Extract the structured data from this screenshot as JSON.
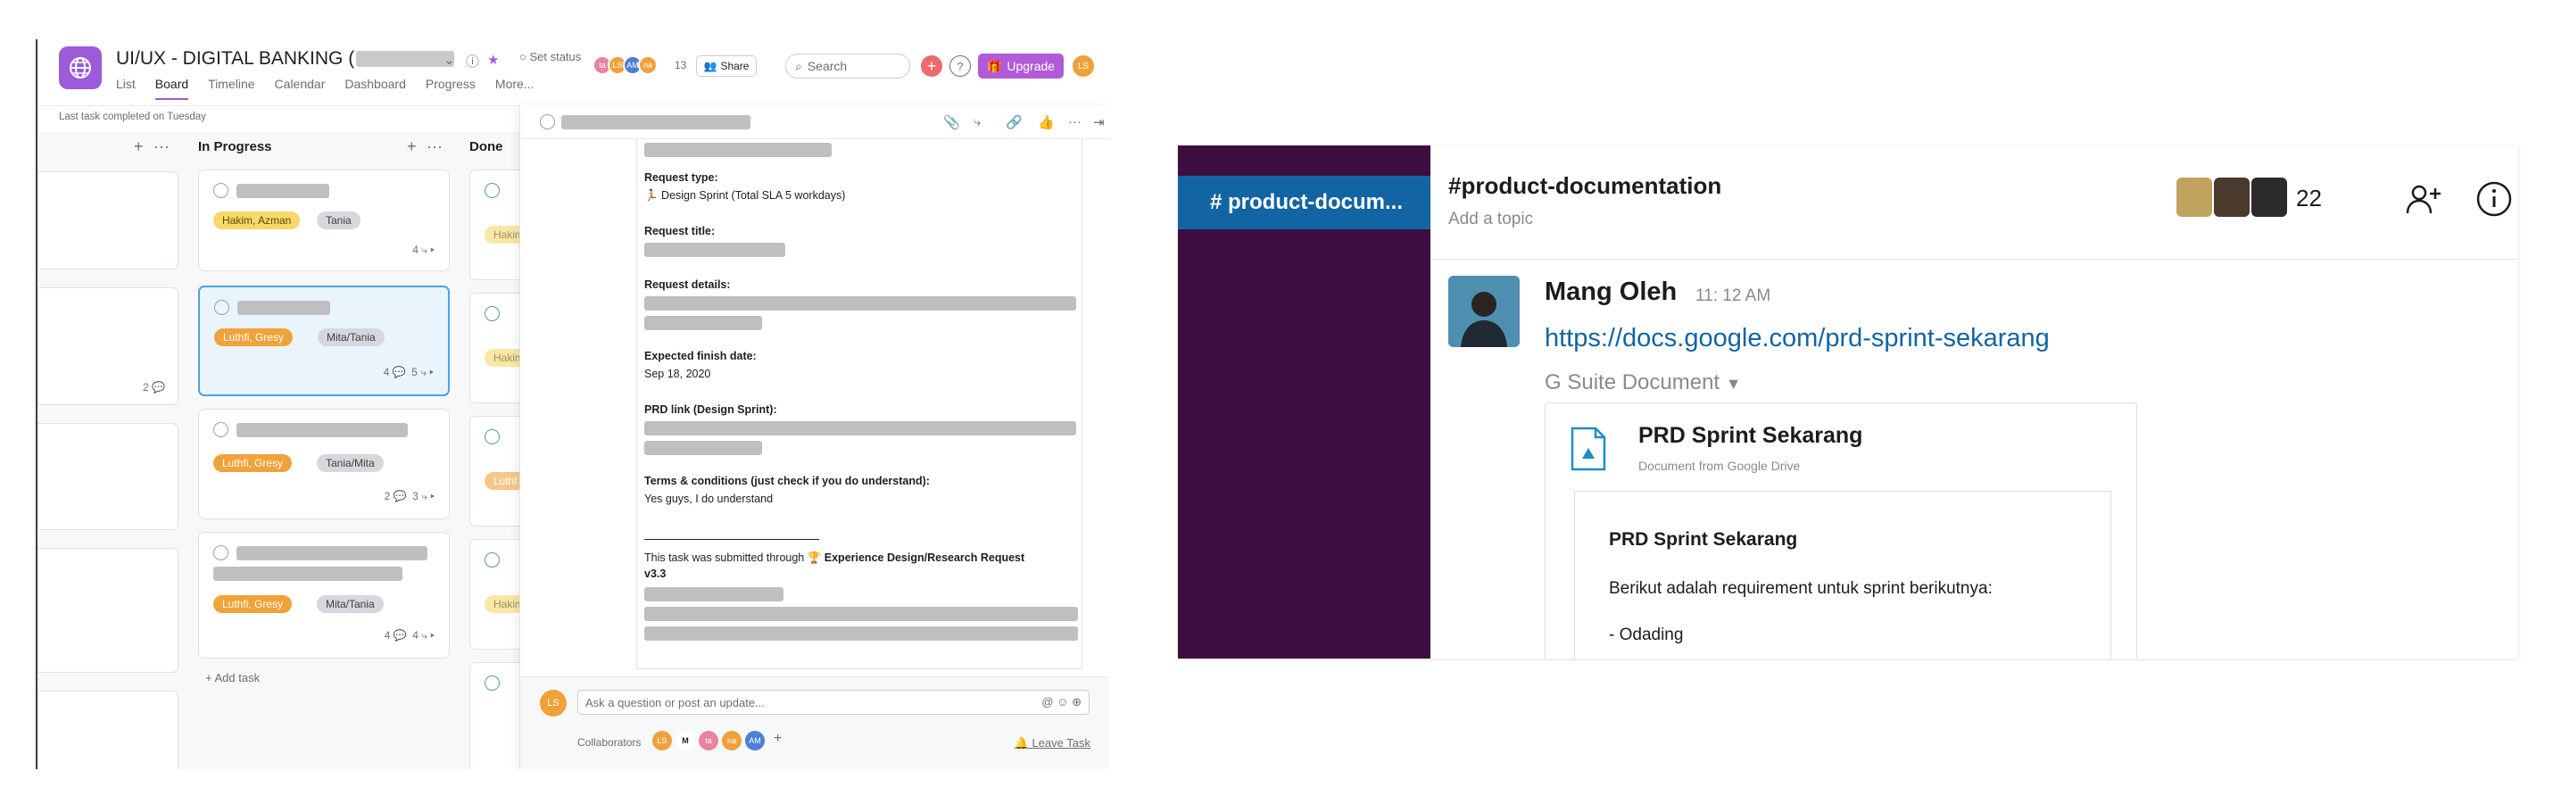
{
  "asana": {
    "project_title": "UI/UX - DIGITAL BANKING (",
    "set_status": "Set status",
    "member_avatars": [
      {
        "initials": "ta",
        "color": "#e8849d"
      },
      {
        "initials": "LS",
        "color": "#f1a13a"
      },
      {
        "initials": "AM",
        "color": "#4b7fd8"
      },
      {
        "initials": "na",
        "color": "#f1a13a"
      }
    ],
    "member_count": "13",
    "share_label": "Share",
    "search_placeholder": "Search",
    "upgrade_label": "Upgrade",
    "user_initials": "LS",
    "tabs": [
      "List",
      "Board",
      "Timeline",
      "Calendar",
      "Dashboard",
      "Progress",
      "More..."
    ],
    "last_task": "Last task completed on Tuesday",
    "columns": {
      "in_progress": "In Progress",
      "done": "Done"
    },
    "left_col_meta": "2",
    "cards": [
      {
        "tags": [
          "Hakim, Azman",
          "Tania"
        ],
        "meta": "4"
      },
      {
        "tags": [
          "Luthfi, Gresy",
          "Mita/Tania"
        ],
        "comments": "4",
        "subtasks": "5"
      },
      {
        "tags": [
          "Luthfi, Gresy",
          "Tania/Mita"
        ],
        "comments": "2",
        "subtasks": "3"
      },
      {
        "tags": [
          "Luthfi, Gresy",
          "Mita/Tania"
        ],
        "comments": "4",
        "subtasks": "4"
      }
    ],
    "done_tags": [
      "Hakim",
      "Hakim",
      "Luthf",
      "Hakim"
    ],
    "add_task": "Add task",
    "detail": {
      "request_type_label": "Request type:",
      "request_type_value": "Design Sprint (Total SLA 5 workdays)",
      "request_title_label": "Request title:",
      "request_details_label": "Request details:",
      "finish_date_label": "Expected finish date:",
      "finish_date_value": "Sep 18, 2020",
      "prd_link_label": "PRD link (Design Sprint):",
      "terms_label": "Terms & conditions (just check if you do understand):",
      "terms_value": "Yes guys, I do understand",
      "submitted_prefix": "This task was submitted through",
      "submitted_form": "Experience Design/Research Request",
      "submitted_version": "v3.3",
      "comment_placeholder": "Ask a question or post an update...",
      "collaborators_label": "Collaborators",
      "collaborators": [
        {
          "initials": "LS",
          "color": "#f1a13a"
        },
        {
          "initials": "M",
          "color": "#ffffff"
        },
        {
          "initials": "ta",
          "color": "#e8849d"
        },
        {
          "initials": "na",
          "color": "#f1a13a"
        },
        {
          "initials": "AM",
          "color": "#4b7fd8"
        }
      ],
      "leave_task": "Leave Task"
    }
  },
  "slack": {
    "sidebar_channel": "# product-docum...",
    "channel_name": "#product-documentation",
    "topic_placeholder": "Add a topic",
    "member_count": "22",
    "message": {
      "author": "Mang Oleh",
      "time": "11: 12 AM",
      "link": "https://docs.google.com/prd-sprint-sekarang",
      "attachment_source": "G Suite Document",
      "attachment_title": "PRD Sprint Sekarang",
      "attachment_subtitle": "Document from Google Drive",
      "preview_title": "PRD Sprint Sekarang",
      "preview_line1": "Berikut adalah requirement untuk sprint berikutnya:",
      "preview_line2": "- Odading"
    }
  }
}
